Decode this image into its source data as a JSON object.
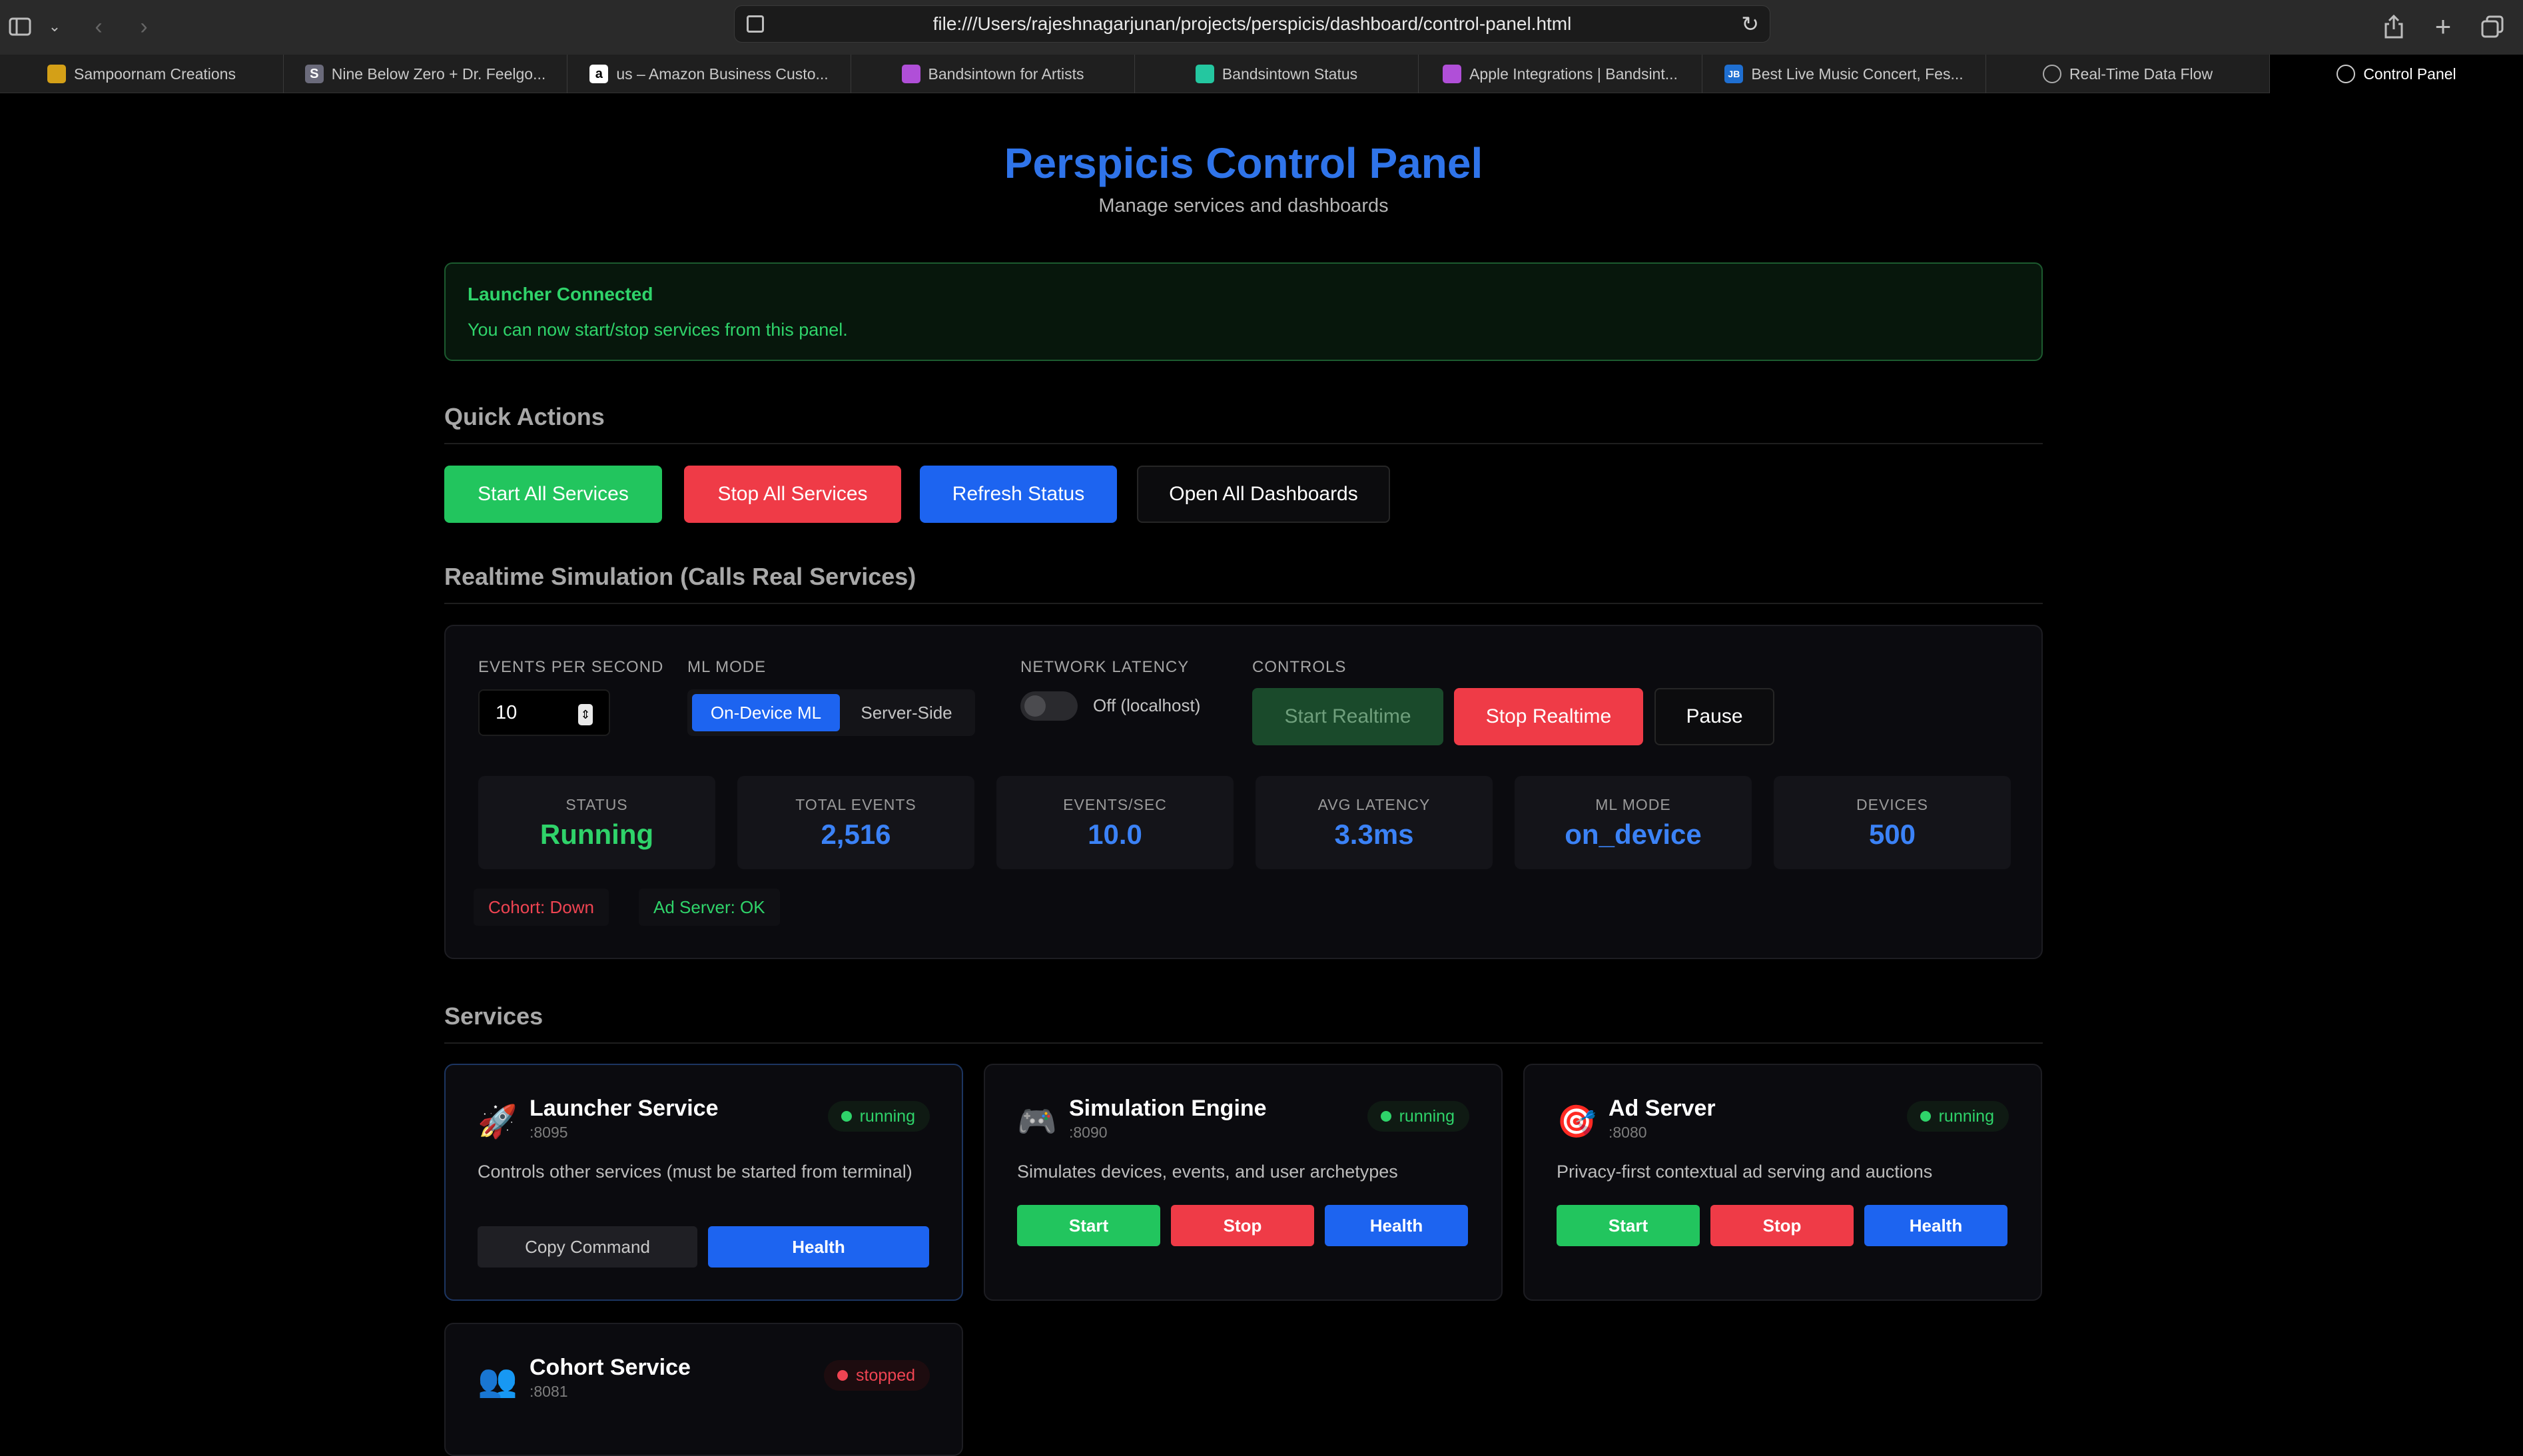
{
  "browser": {
    "url": "file:///Users/rajeshnagarjunan/projects/perspicis/dashboard/control-panel.html",
    "tabs": [
      {
        "label": "Sampoornam Creations",
        "fav": "",
        "color": "#d4a017"
      },
      {
        "label": "Nine Below Zero + Dr. Feelgo...",
        "fav": "S",
        "color": "#6b6b7b"
      },
      {
        "label": "us – Amazon Business Custo...",
        "fav": "a",
        "color": "#ffffff"
      },
      {
        "label": "Bandsintown for Artists",
        "fav": "",
        "color": "#b04fd8"
      },
      {
        "label": "Bandsintown Status",
        "fav": "",
        "color": "#24c7a0"
      },
      {
        "label": "Apple Integrations | Bandsint...",
        "fav": "",
        "color": "#b04fd8"
      },
      {
        "label": "Best Live Music Concert, Fes...",
        "fav": "JB",
        "color": "#1f6fd1"
      },
      {
        "label": "Real-Time Data Flow",
        "fav": "",
        "color": "#555555"
      },
      {
        "label": "Control Panel",
        "fav": "",
        "color": "#555555"
      }
    ]
  },
  "header": {
    "title": "Perspicis Control Panel",
    "subtitle": "Manage services and dashboards"
  },
  "alert": {
    "title": "Launcher Connected",
    "text": "You can now start/stop services from this panel."
  },
  "quick_actions": {
    "heading": "Quick Actions",
    "start_all": "Start All Services",
    "stop_all": "Stop All Services",
    "refresh": "Refresh Status",
    "open_all": "Open All Dashboards"
  },
  "simulation": {
    "heading": "Realtime Simulation (Calls Real Services)",
    "events_per_second_label": "EVENTS PER SECOND",
    "events_per_second": "10",
    "ml_mode_label": "ML MODE",
    "ml_on_device": "On-Device ML",
    "ml_server_side": "Server-Side",
    "network_latency_label": "NETWORK LATENCY",
    "network_latency_value": "Off (localhost)",
    "controls_label": "CONTROLS",
    "start_realtime": "Start Realtime",
    "stop_realtime": "Stop Realtime",
    "pause": "Pause",
    "stats": {
      "status_label": "STATUS",
      "status": "Running",
      "total_events_label": "TOTAL EVENTS",
      "total_events": "2,516",
      "events_sec_label": "EVENTS/SEC",
      "events_sec": "10.0",
      "avg_latency_label": "AVG LATENCY",
      "avg_latency": "3.3ms",
      "ml_mode_label": "ML MODE",
      "ml_mode": "on_device",
      "devices_label": "DEVICES",
      "devices": "500"
    },
    "cohort_chip": "Cohort: Down",
    "adserver_chip": "Ad Server: OK"
  },
  "services": {
    "heading": "Services",
    "items": [
      {
        "name": "Launcher Service",
        "port": ":8095",
        "status": "running",
        "icon": "rocket-icon",
        "desc": "Controls other services (must be started from terminal)",
        "btn1": "Copy Command",
        "btn2": "Health"
      },
      {
        "name": "Simulation Engine",
        "port": ":8090",
        "status": "running",
        "icon": "gamepad-icon",
        "desc": "Simulates devices, events, and user archetypes",
        "btn1": "Start",
        "btn2": "Stop",
        "btn3": "Health"
      },
      {
        "name": "Ad Server",
        "port": ":8080",
        "status": "running",
        "icon": "target-icon",
        "desc": "Privacy-first contextual ad serving and auctions",
        "btn1": "Start",
        "btn2": "Stop",
        "btn3": "Health"
      },
      {
        "name": "Cohort Service",
        "port": ":8081",
        "status": "stopped",
        "icon": "users-icon"
      }
    ]
  }
}
